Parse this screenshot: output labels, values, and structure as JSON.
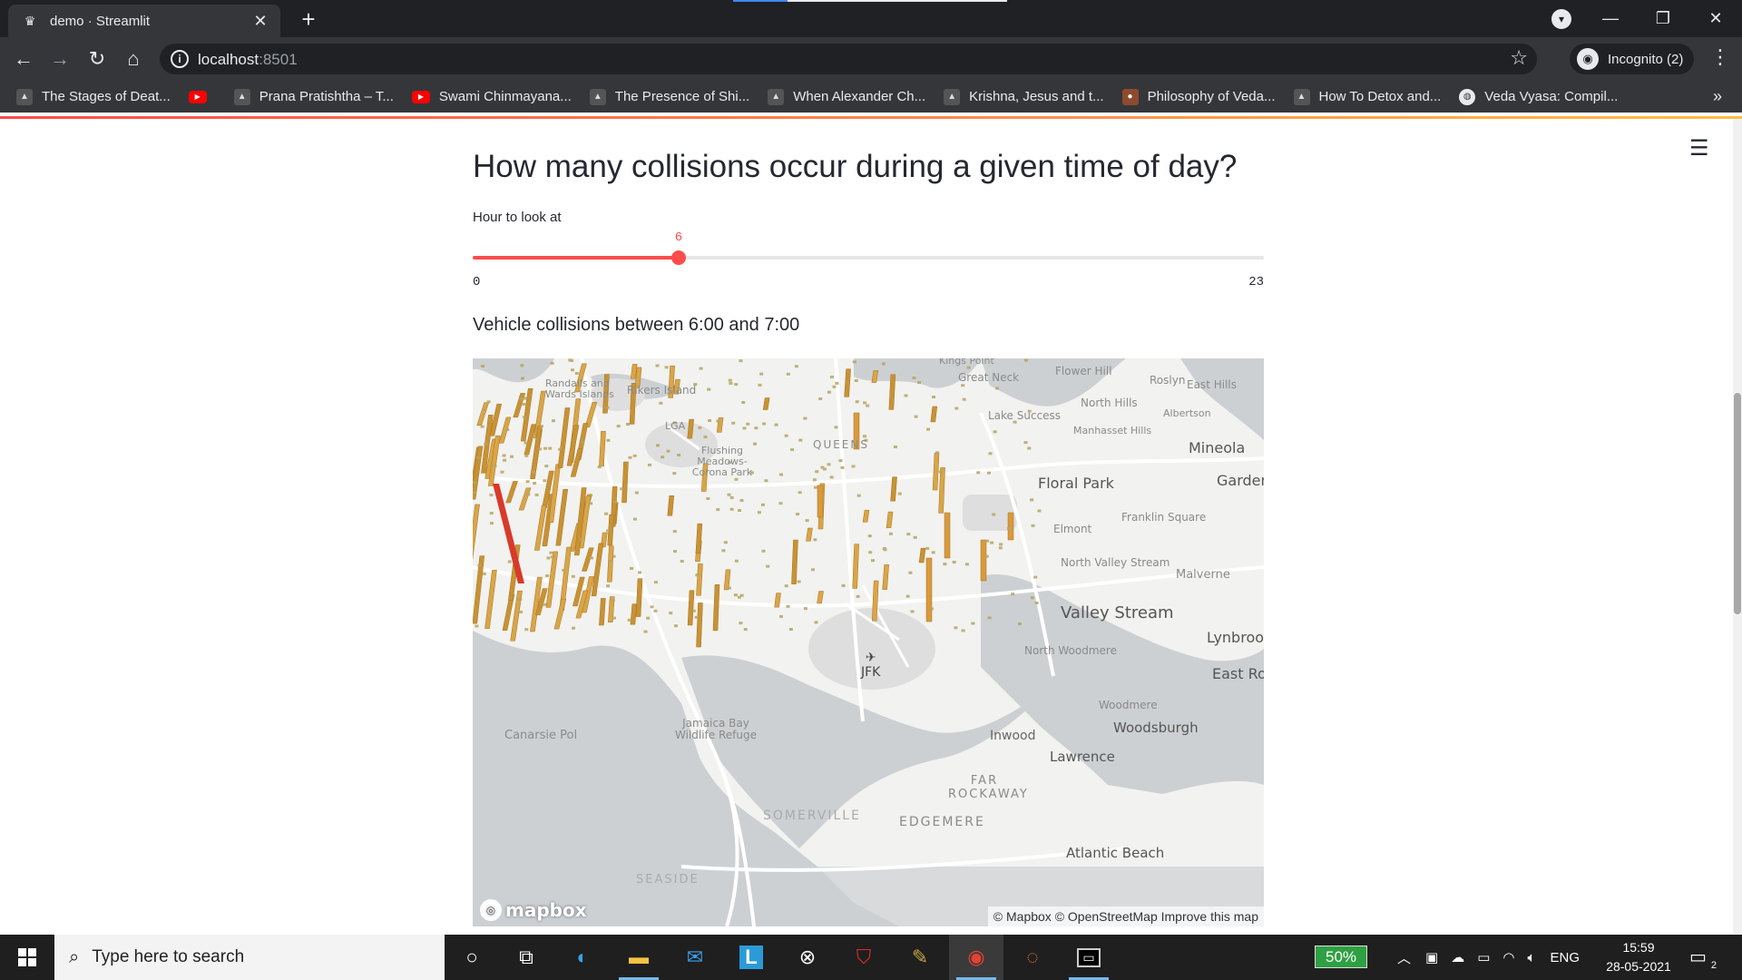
{
  "browser": {
    "tab_title": "demo · Streamlit",
    "new_tab_symbol": "+",
    "url_host": "localhost",
    "url_port": ":8501",
    "incognito_label": "Incognito (2)",
    "bookmarks": [
      {
        "label": "The Stages of Deat...",
        "icon": "mountain-icon"
      },
      {
        "label": "",
        "icon": "youtube-icon"
      },
      {
        "label": "Prana Pratishtha – T...",
        "icon": "mountain-icon"
      },
      {
        "label": "Swami Chinmayana...",
        "icon": "youtube-icon"
      },
      {
        "label": "The Presence of Shi...",
        "icon": "mountain-icon"
      },
      {
        "label": "When Alexander Ch...",
        "icon": "mountain-icon"
      },
      {
        "label": "Krishna, Jesus and t...",
        "icon": "mountain-icon"
      },
      {
        "label": "Philosophy of Veda...",
        "icon": "person-icon"
      },
      {
        "label": "How To Detox and...",
        "icon": "mountain-icon"
      },
      {
        "label": "Veda Vyasa: Compil...",
        "icon": "globe-icon"
      }
    ],
    "bookmarks_overflow": "»"
  },
  "app": {
    "heading": "How many collisions occur during a given time of day?",
    "slider": {
      "label": "Hour to look at",
      "value": 6,
      "min": 0,
      "max": 23,
      "min_label": "0",
      "max_label": "23",
      "value_label": "6",
      "accent": "#ff4b4b"
    },
    "subheading": "Vehicle collisions between 6:00 and 7:00",
    "map": {
      "attribution": "© Mapbox © OpenStreetMap Improve this map",
      "logo_text": "mapbox",
      "labels": [
        "Kings Point",
        "Great Neck",
        "Flower Hill",
        "Roslyn",
        "East Hills",
        "Randalls and Wards Islands",
        "Rikers Island",
        "LGA",
        "North Hills",
        "Albertson",
        "Lake Success",
        "Manhasset Hills",
        "Mineola",
        "QUEENS",
        "Flushing Meadows-Corona Park",
        "Floral Park",
        "Garden",
        "Franklin Square",
        "Elmont",
        "North Valley Stream",
        "Malverne",
        "Valley Stream",
        "Lynbrook",
        "North Woodmere",
        "East Rockaway",
        "JFK",
        "Woodmere",
        "Woodsburgh",
        "Jamaica Bay Wildlife Refuge",
        "Canarsie Pol",
        "Inwood",
        "Lawrence",
        "FAR ROCKAWAY",
        "SOMERVILLE",
        "EDGEMERE",
        "Atlantic Beach",
        "SEASIDE"
      ]
    }
  },
  "taskbar": {
    "search_placeholder": "Type here to search",
    "battery": "50%",
    "language": "ENG",
    "time": "15:59",
    "date": "28-05-2021",
    "notifications": "2"
  },
  "colors": {
    "chrome_dark": "#202124",
    "chrome_mid": "#35363a",
    "streamlit_red": "#ff4b4b",
    "text": "#262730"
  }
}
